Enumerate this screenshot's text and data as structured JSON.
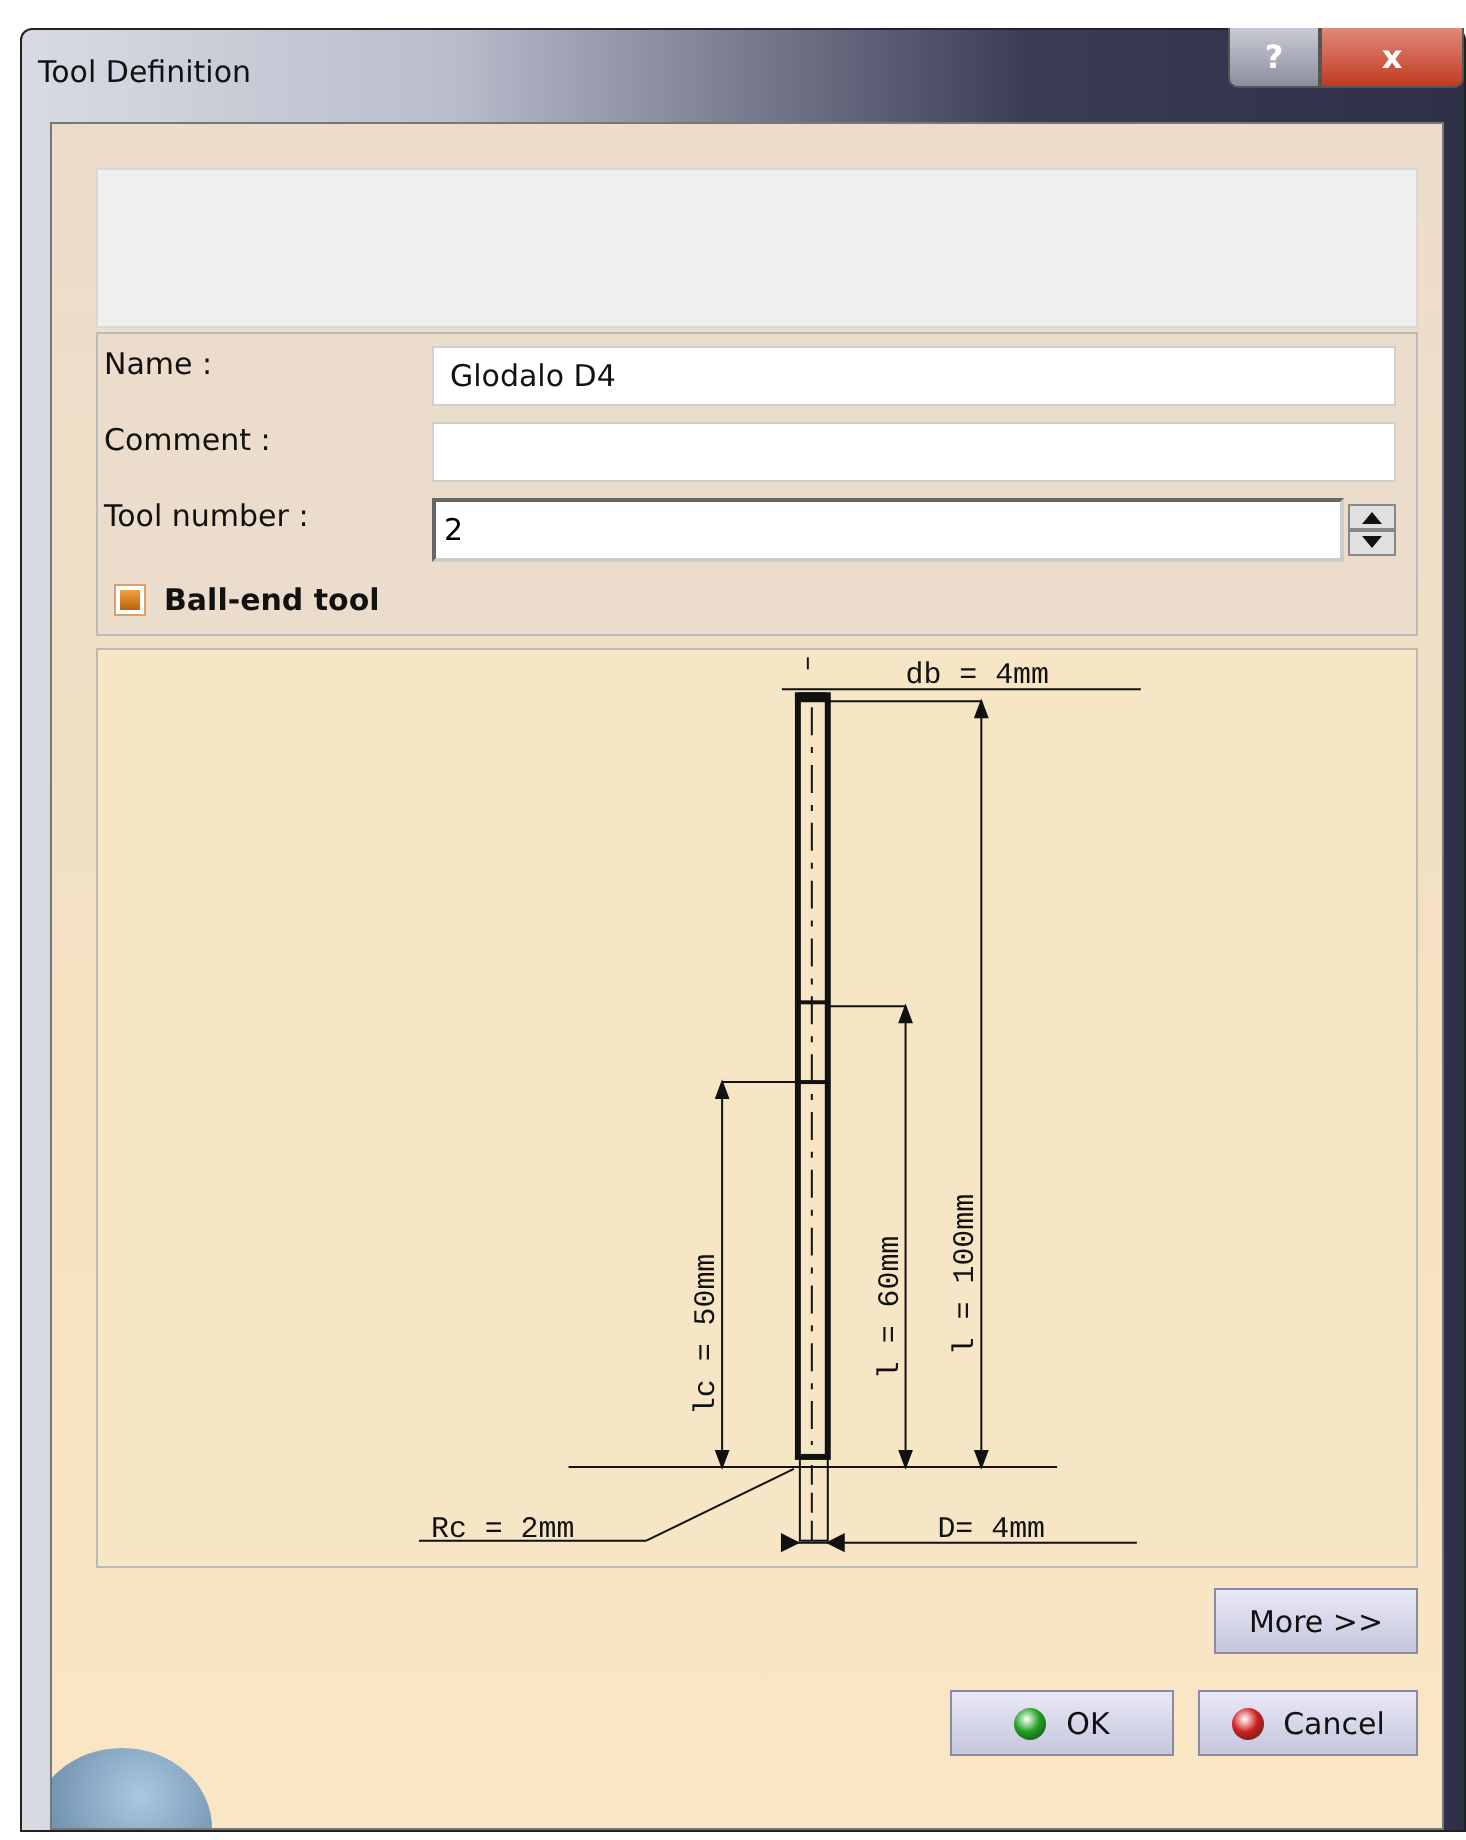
{
  "window": {
    "title": "Tool Definition",
    "help_button": "?",
    "close_button": "x"
  },
  "fields": [
    {
      "kind": "text",
      "label": "Name :",
      "value": "Glodalo D4"
    },
    {
      "kind": "text",
      "label": "Comment :"
    },
    {
      "kind": "spin",
      "label": "Tool number :",
      "value": "2"
    }
  ],
  "ball_end": {
    "label": "Ball-end tool",
    "checked": true
  },
  "drawing": {
    "db": "db = 4mm",
    "l": "l = 100mm",
    "l_cut": "l = 60mm",
    "lc": "lc = 50mm",
    "rc": "Rc = 2mm",
    "d": "D= 4mm"
  },
  "buttons": [
    {
      "kind": "more",
      "label": "More >>"
    },
    {
      "kind": "ok",
      "label": "OK"
    },
    {
      "kind": "cancel",
      "label": "Cancel"
    }
  ]
}
